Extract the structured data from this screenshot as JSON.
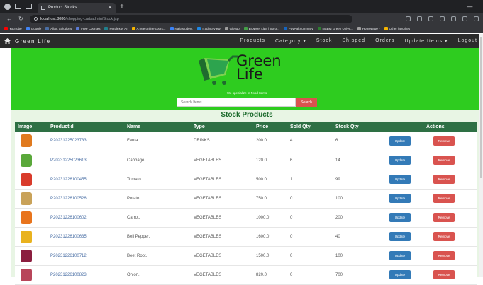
{
  "browser": {
    "tab_title": "Product Stocks",
    "url_host": "localhost:8080",
    "url_path": "/shopping-cart/admin/Stock.jsp",
    "bookmarks": [
      {
        "label": "YouTube",
        "color": "#ff0000"
      },
      {
        "label": "Google",
        "color": "#4285f4"
      },
      {
        "label": "Allart Solutions",
        "color": "#4a6fa5"
      },
      {
        "label": "Free Courses",
        "color": "#5b7bd5"
      },
      {
        "label": "Perplexity AI",
        "color": "#20808d"
      },
      {
        "label": "A free online cours...",
        "color": "#f4b400"
      },
      {
        "label": "Naijastudent",
        "color": "#3b82f6"
      },
      {
        "label": "Trading View",
        "color": "#1e88e5"
      },
      {
        "label": "GitHub",
        "color": "#9e9e9e"
      },
      {
        "label": "Browser Lipa | Spro...",
        "color": "#43a047"
      },
      {
        "label": "PayPal Summary",
        "color": "#1565c0"
      },
      {
        "label": "NSBM Green Unive...",
        "color": "#2e7d32"
      },
      {
        "label": "Homepage -",
        "color": "#9e9e9e"
      },
      {
        "label": "Other favorites",
        "color": "#f4b400"
      }
    ]
  },
  "site": {
    "brand": "Green Life",
    "menu": [
      "Products",
      "Category ▾",
      "Stock",
      "Shipped",
      "Orders",
      "Update Items ▾",
      "Logout"
    ],
    "logo_line1": "Green",
    "logo_line2": "Life",
    "tagline": "We specialize in Food Items",
    "search_placeholder": "Search Items",
    "search_button": "Search"
  },
  "stock": {
    "title": "Stock Products",
    "columns": [
      "Image",
      "ProductId",
      "Name",
      "Type",
      "Price",
      "Sold Qty",
      "Stock Qty",
      "",
      "Actions"
    ],
    "update_label": "Update",
    "remove_label": "Remove",
    "rows": [
      {
        "icon": "drink-bottle-icon",
        "color": "#e07a1f",
        "id": "P20231225023733",
        "name": "Fanta.",
        "type": "DRINKS",
        "price": "200.0",
        "sold": "4",
        "stock": "6"
      },
      {
        "icon": "cabbage-icon",
        "color": "#5aa83a",
        "id": "P20231225023613",
        "name": "Cabbage.",
        "type": "VEGETABLES",
        "price": "120.0",
        "sold": "6",
        "stock": "14"
      },
      {
        "icon": "tomato-icon",
        "color": "#d93b2b",
        "id": "P20231226100455",
        "name": "Tomato.",
        "type": "VEGETABLES",
        "price": "500.0",
        "sold": "1",
        "stock": "99"
      },
      {
        "icon": "potato-icon",
        "color": "#c9a259",
        "id": "P20231226100526",
        "name": "Potato.",
        "type": "VEGETABLES",
        "price": "750.0",
        "sold": "0",
        "stock": "100"
      },
      {
        "icon": "carrot-icon",
        "color": "#e8741c",
        "id": "P20231226100602",
        "name": "Carrot.",
        "type": "VEGETABLES",
        "price": "1000.0",
        "sold": "0",
        "stock": "200"
      },
      {
        "icon": "bell-pepper-icon",
        "color": "#e9b21e",
        "id": "P20231226100635",
        "name": "Bell Pepper.",
        "type": "VEGETABLES",
        "price": "1600.0",
        "sold": "0",
        "stock": "40"
      },
      {
        "icon": "beetroot-icon",
        "color": "#8b1e3f",
        "id": "P20231226100712",
        "name": "Beet Root.",
        "type": "VEGETABLES",
        "price": "1500.0",
        "sold": "0",
        "stock": "100"
      },
      {
        "icon": "onion-icon",
        "color": "#b8455a",
        "id": "P20231226100823",
        "name": "Onion.",
        "type": "VEGETABLES",
        "price": "820.0",
        "sold": "0",
        "stock": "700"
      }
    ]
  }
}
